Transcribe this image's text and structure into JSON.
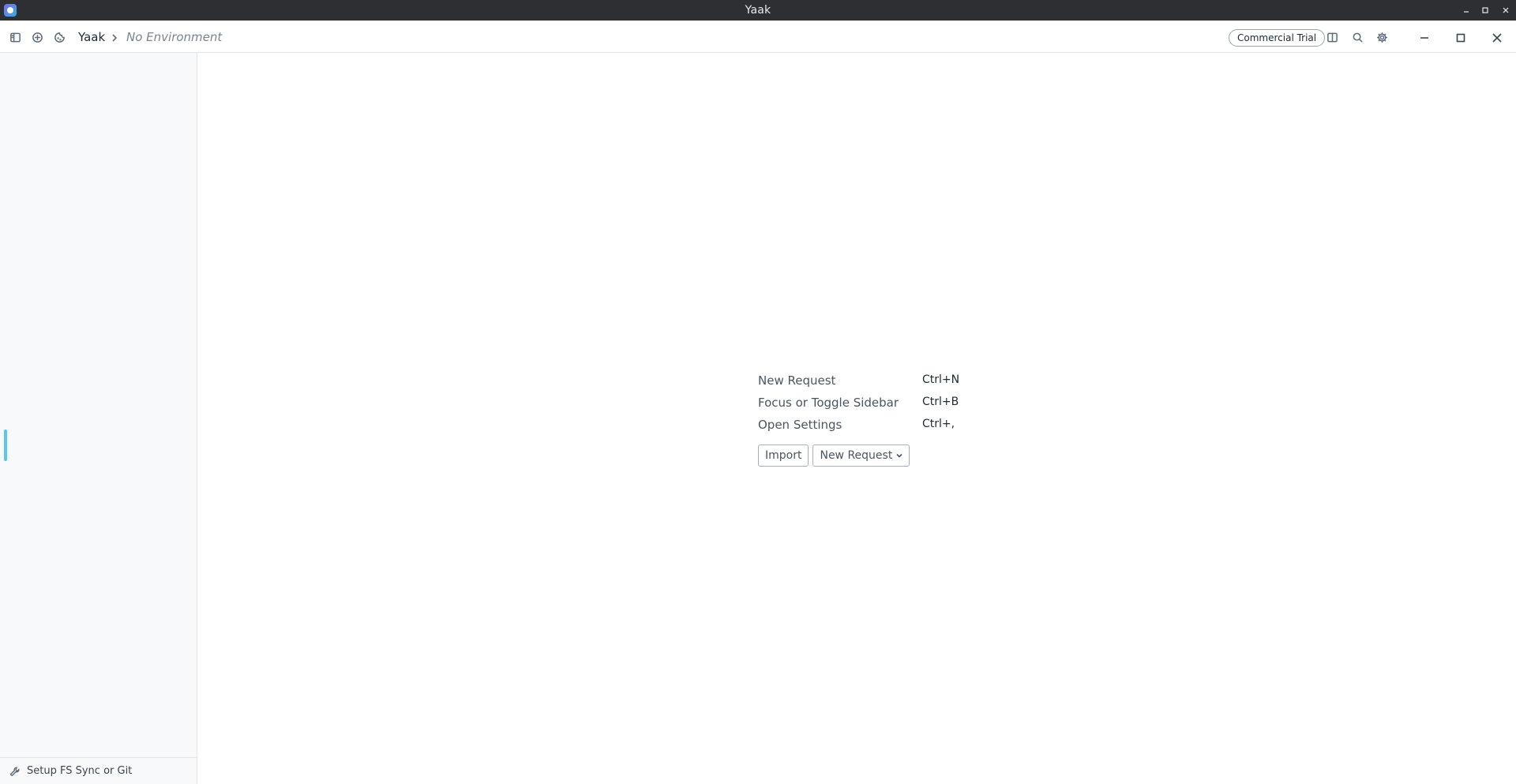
{
  "window": {
    "title": "Yaak"
  },
  "header": {
    "workspace": "Yaak",
    "environment": "No Environment",
    "license_badge": "Commercial Trial"
  },
  "sidebar": {
    "footer_label": "Setup FS Sync or Git"
  },
  "empty_state": {
    "shortcuts": [
      {
        "label": "New Request",
        "keys": "Ctrl+N"
      },
      {
        "label": "Focus or Toggle Sidebar",
        "keys": "Ctrl+B"
      },
      {
        "label": "Open Settings",
        "keys": "Ctrl+,"
      }
    ],
    "import_label": "Import",
    "new_request_label": "New Request"
  },
  "icons": {
    "sidebar_toggle": "panel-left-icon",
    "new": "plus-circle-icon",
    "cookies": "cookie-icon",
    "layout": "split-layout-icon",
    "search": "search-icon",
    "settings": "gear-icon",
    "footer": "wrench-icon"
  },
  "colors": {
    "accent": "#58c7f3",
    "titlebar": "#2d2f33"
  }
}
